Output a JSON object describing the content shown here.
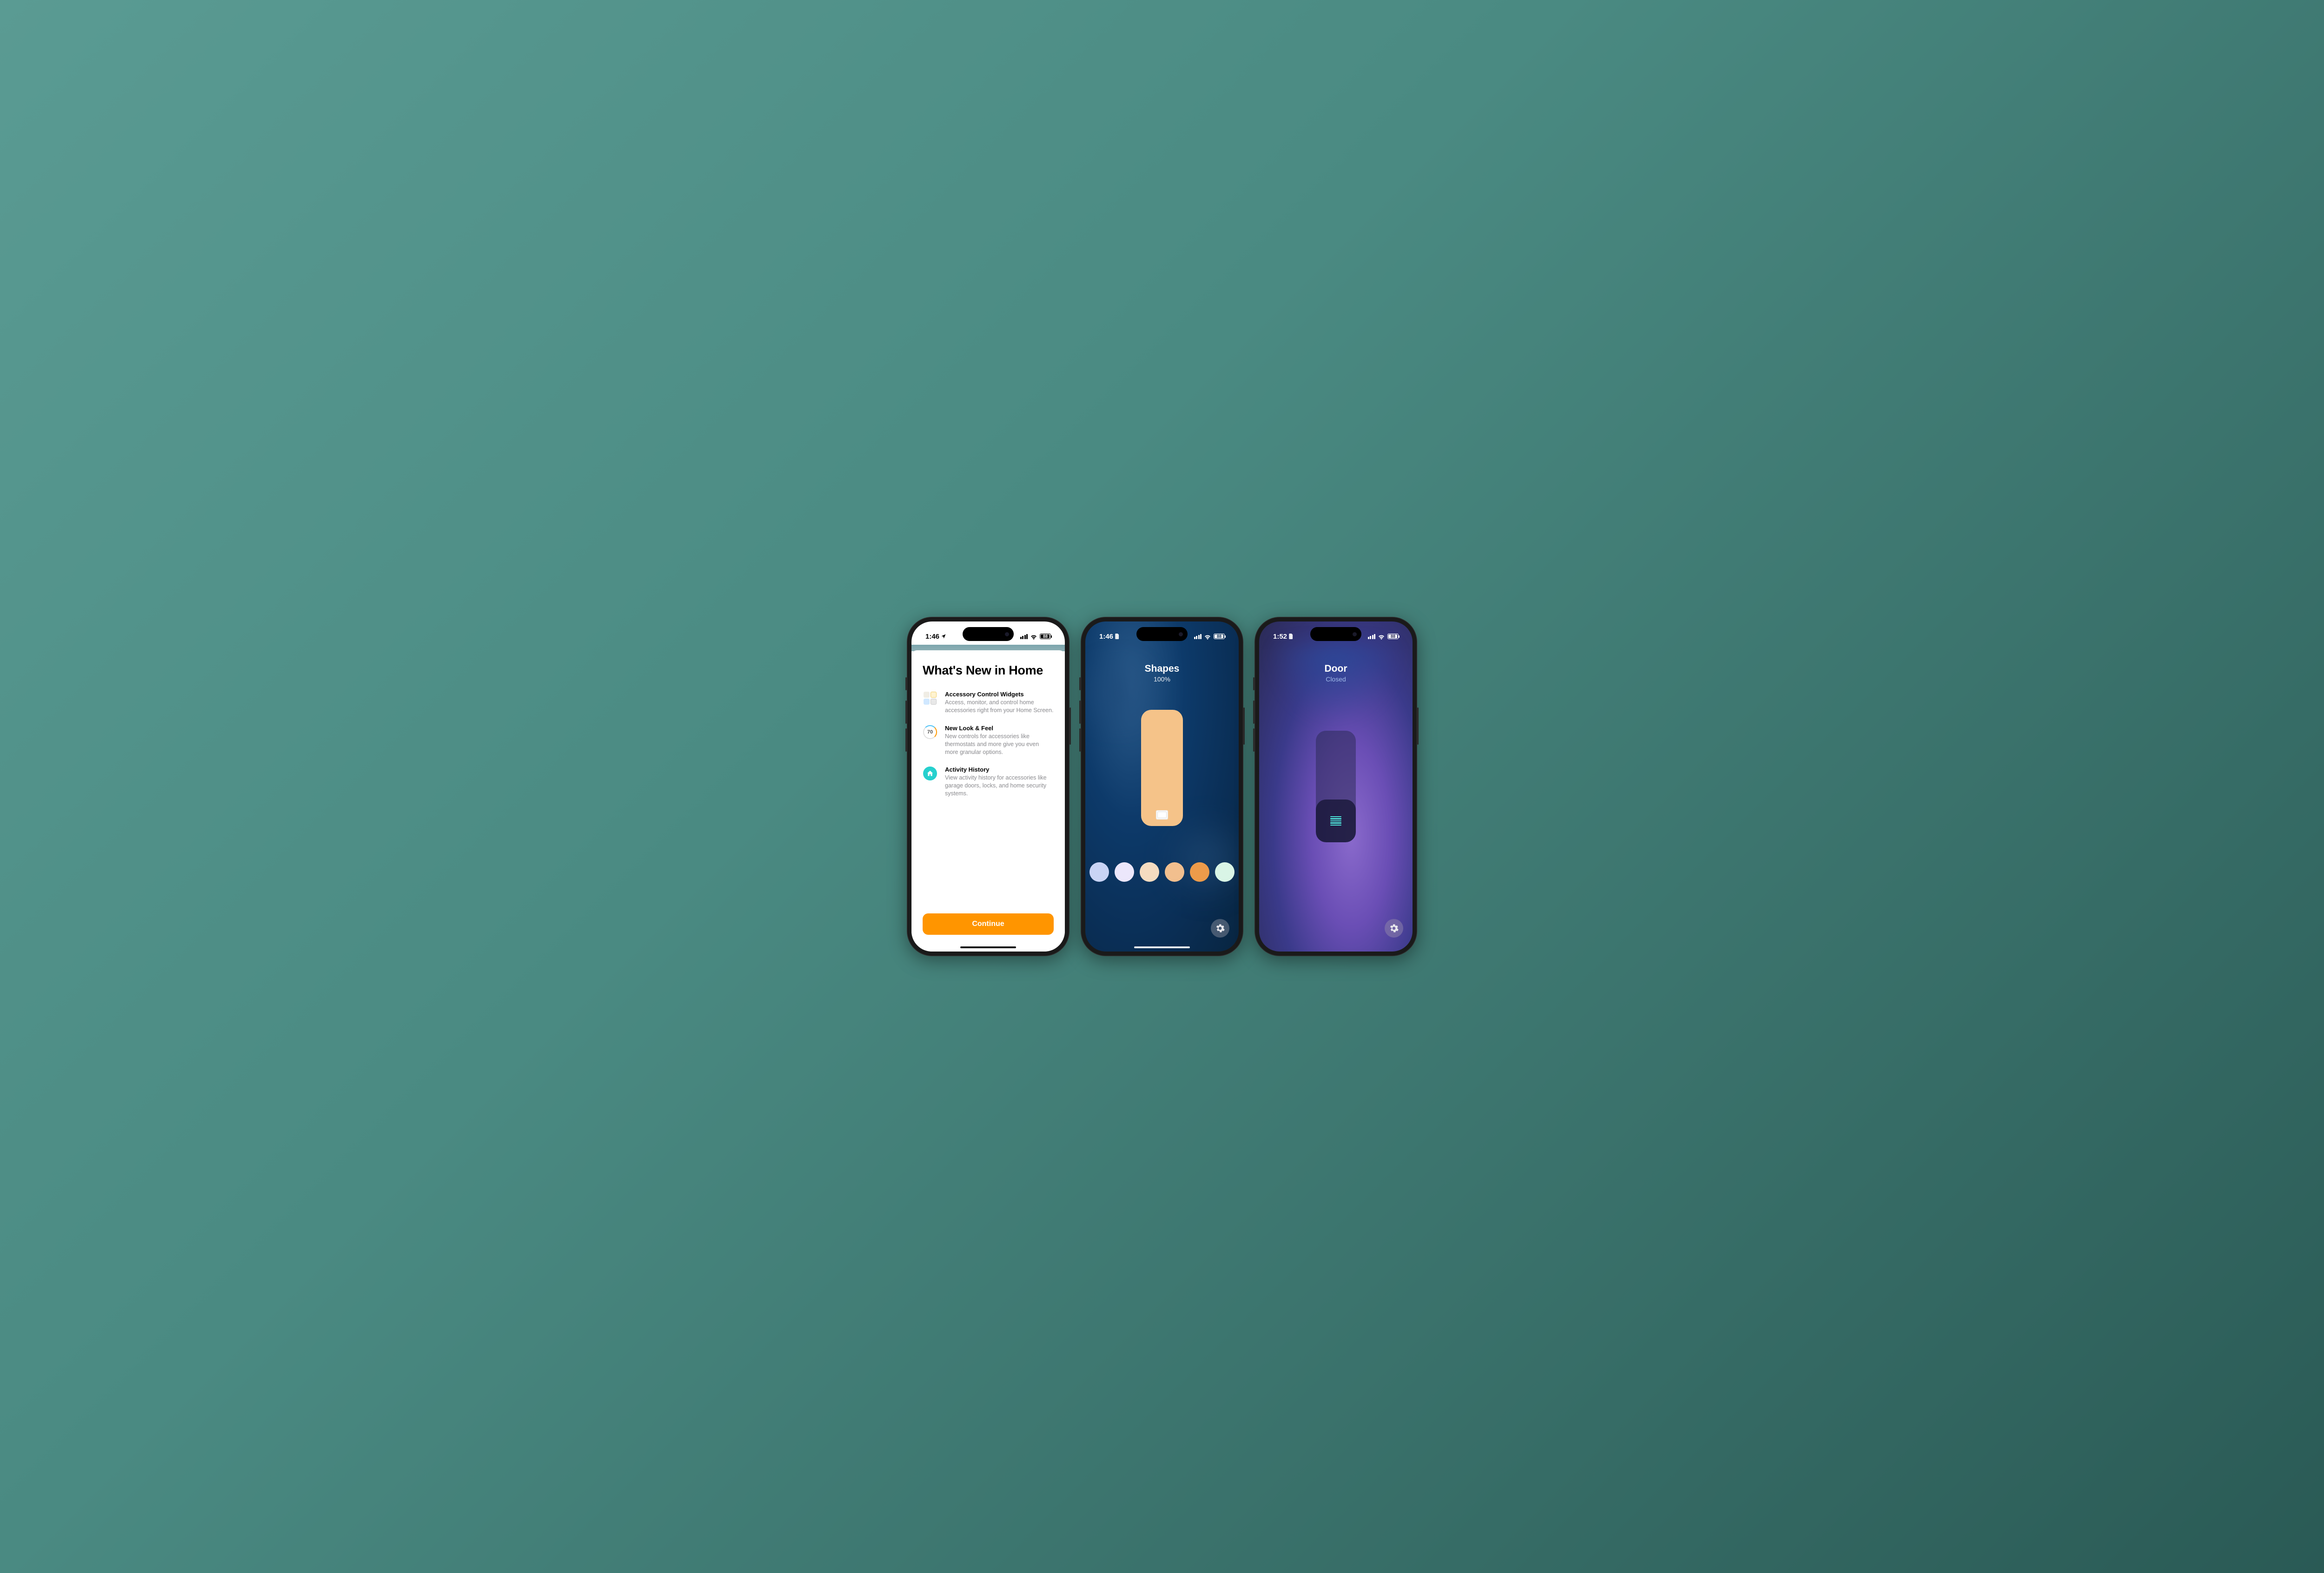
{
  "phone1": {
    "status": {
      "time": "1:46",
      "battery": "88"
    },
    "title": "What's New in Home",
    "features": [
      {
        "title": "Accessory Control Widgets",
        "desc": "Access, monitor, and control home accessories right from your Home Screen."
      },
      {
        "title": "New Look & Feel",
        "desc": "New controls for accessories like thermostats and more give you even more granular options.",
        "icon_value": "70"
      },
      {
        "title": "Activity History",
        "desc": "View activity history for accessories like garage doors, locks, and home security systems."
      }
    ],
    "continue_label": "Continue"
  },
  "phone2": {
    "status": {
      "time": "1:46",
      "battery": "88"
    },
    "accessory_name": "Shapes",
    "brightness_percent": "100%",
    "color_swatches": [
      "#c9d4f5",
      "#ece7fb",
      "#f5dcc0",
      "#f2bf8e",
      "#ed9b4a",
      "#d9f5e6"
    ]
  },
  "phone3": {
    "status": {
      "time": "1:52",
      "battery": "88"
    },
    "accessory_name": "Door",
    "state": "Closed"
  }
}
